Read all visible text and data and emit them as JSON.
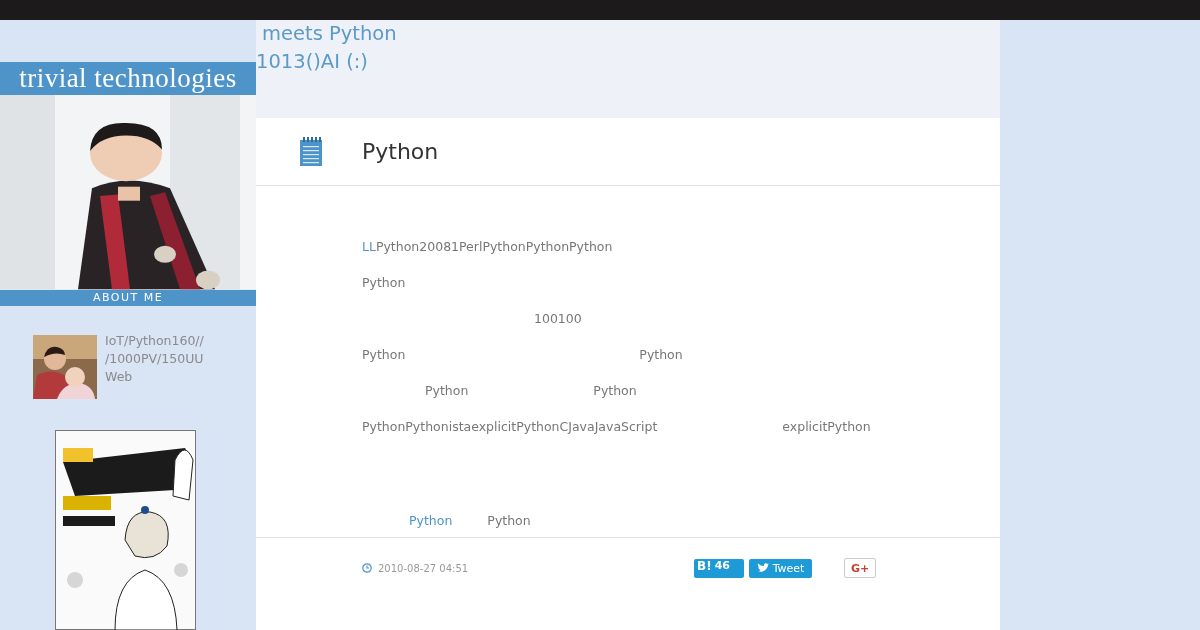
{
  "sidebar": {
    "blog_title": "trivial technologies",
    "about_label": "ABOUT ME",
    "profile_lines": [
      "IoT/Python160//",
      "/1000PV/150UU",
      "Web"
    ]
  },
  "header": {
    "lines": [
      "meets Python",
      "1013()AI (:)"
    ]
  },
  "article": {
    "title": "Python",
    "body": [
      [
        {
          "text": "LL",
          "link": true
        },
        {
          "text": "Python20081PerlPythonPythonPython",
          "link": false
        }
      ],
      [
        {
          "text": "Python",
          "link": false
        }
      ],
      [
        {
          "text": "100100",
          "link": false
        }
      ],
      [
        {
          "text": "Python",
          "link": false
        },
        {
          "text": "Python",
          "link": false
        }
      ],
      [
        {
          "text": "Python",
          "link": false
        },
        {
          "text": "Python",
          "link": false
        }
      ],
      [
        {
          "text": "PythonPythonistaexplicitPythonCJavaJavaScript",
          "link": false
        },
        {
          "text": "explicitPython",
          "link": false
        }
      ],
      [
        {
          "text": "Python",
          "link": true
        },
        {
          "text": "Python",
          "link": false
        }
      ]
    ],
    "date": "2010-08-27 04:51",
    "share": {
      "hatena_label": "B!",
      "hatena_count": "46",
      "tweet": "Tweet",
      "gplus": "G+"
    }
  }
}
